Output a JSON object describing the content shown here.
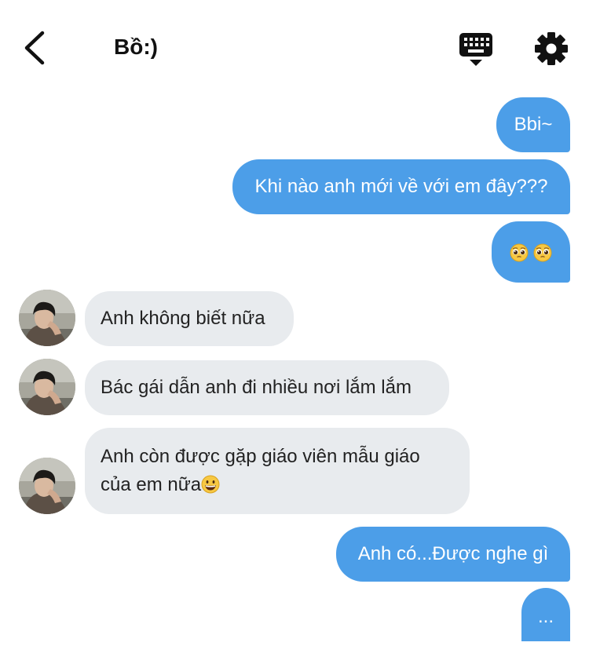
{
  "header": {
    "title": "Bồ:)",
    "back_icon": "chevron-left-icon",
    "keyboard_icon": "keyboard-icon",
    "settings_icon": "gear-icon"
  },
  "colors": {
    "outgoing_bubble": "#4c9ee8",
    "incoming_bubble": "#e8ebee",
    "background": "#ffffff"
  },
  "messages": [
    {
      "direction": "out",
      "text": "Bbi~"
    },
    {
      "direction": "out",
      "text": "Khi nào anh mới về với em đây???"
    },
    {
      "direction": "out",
      "text": "",
      "emoji": [
        "pleading-face",
        "pleading-face"
      ]
    },
    {
      "direction": "in",
      "text": "Anh không biết nữa"
    },
    {
      "direction": "in",
      "text": "Bác gái dẫn anh đi nhiều nơi lắm lắm"
    },
    {
      "direction": "in",
      "lines": [
        "Anh còn được gặp giáo viên mẫu giáo",
        "của em nữa"
      ],
      "emoji": [
        "grinning-face"
      ]
    },
    {
      "direction": "out",
      "text": "Anh có...Được nghe gì"
    },
    {
      "direction": "out",
      "text": "..."
    }
  ]
}
